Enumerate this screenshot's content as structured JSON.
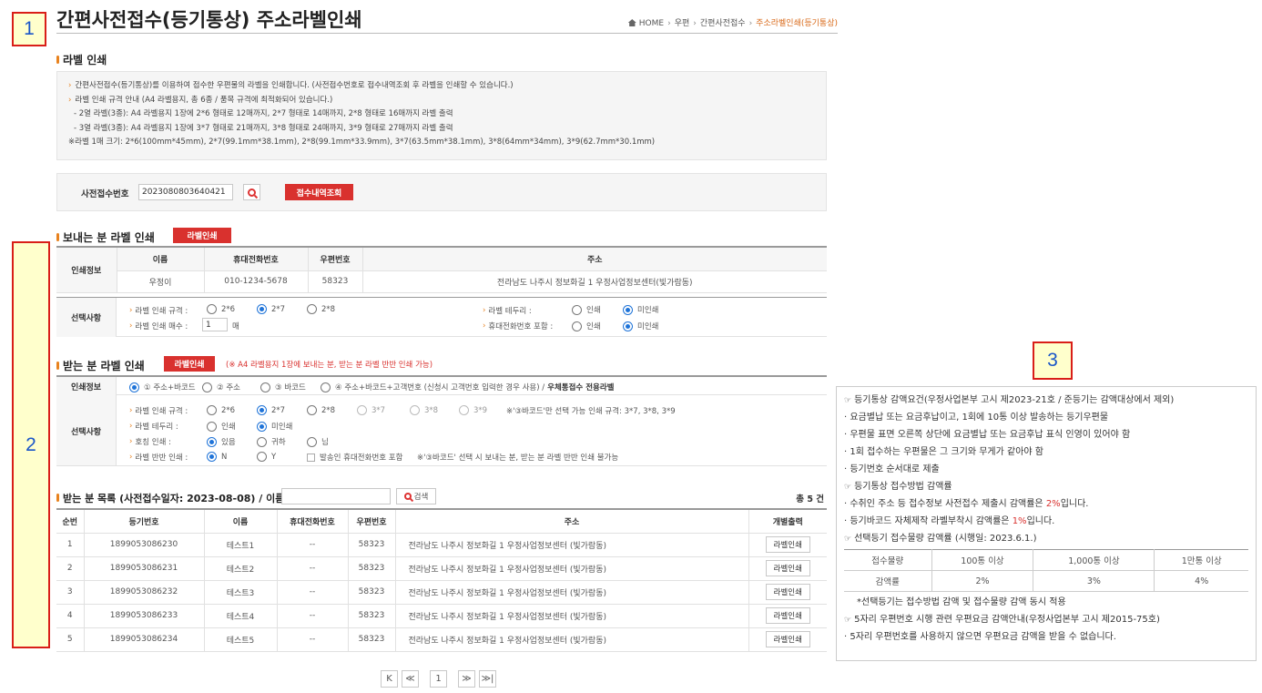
{
  "callouts": [
    "1",
    "2",
    "3"
  ],
  "page_title": "간편사전접수(등기통상) 주소라벨인쇄",
  "breadcrumb": {
    "home": "HOME",
    "items": [
      "우편",
      "간편사전접수",
      "주소라벨인쇄(등기통상)"
    ]
  },
  "label_print": {
    "heading": "라벨 인쇄",
    "info": [
      "간편사전접수(등기통상)를 이용하여 접수한 우편물의 라벨을 인쇄합니다. (사전접수번호로 접수내역조회 후 라벨을 인쇄할 수 있습니다.)",
      "라벨 인쇄 규격 안내 (A4 라벨용지, 총 6종 / 품목 규격에 최적화되어 있습니다.)",
      "- 2열 라벨(3종): A4 라벨용지 1장에 2*6 형태로 12매까지, 2*7 형태로 14매까지, 2*8 형태로 16매까지 라벨 출력",
      "- 3열 라벨(3종): A4 라벨용지 1장에 3*7 형태로 21매까지, 3*8 형태로 24매까지, 3*9 형태로 27매까지 라벨 출력",
      "※라벨 1매 크기: 2*6(100mm*45mm), 2*7(99.1mm*38.1mm), 2*8(99.1mm*33.9mm), 3*7(63.5mm*38.1mm), 3*8(64mm*34mm), 3*9(62.7mm*30.1mm)"
    ]
  },
  "search": {
    "label": "사전접수번호",
    "value": "2023080803640421",
    "button": "접수내역조회"
  },
  "sender": {
    "heading": "보내는 분 라벨 인쇄",
    "print_button": "라벨인쇄",
    "row_label": "인쇄정보",
    "columns": [
      "이름",
      "휴대전화번호",
      "우편번호",
      "주소"
    ],
    "values": [
      "우정이",
      "010-1234-5678",
      "58323",
      "전라남도 나주시 정보화길 1 우정사업정보센터(빛가람동)"
    ],
    "options_label": "선택사항",
    "size_label": "라벨 인쇄 규격 :",
    "sizes": [
      "2*6",
      "2*7",
      "2*8"
    ],
    "size_selected": "2*7",
    "count_label": "라벨 인쇄 매수 :",
    "count_value": "1",
    "count_unit": "매",
    "border_label": "라벨 테두리 :",
    "border_options": [
      "인쇄",
      "미인쇄"
    ],
    "border_selected": "미인쇄",
    "phone_label": "휴대전화번호 포함 :",
    "phone_options": [
      "인쇄",
      "미인쇄"
    ],
    "phone_selected": "미인쇄"
  },
  "receiver": {
    "heading": "받는 분 라벨 인쇄",
    "print_button": "라벨인쇄",
    "note": "(※ A4 라벨용지 1장에 보내는 분, 받는 분 라벨 반반 인쇄 가능)",
    "row_label": "인쇄정보",
    "types": [
      "① 주소+바코드",
      "② 주소",
      "③ 바코드",
      "④ 주소+바코드+고객번호 (신청시 고객번호 입력한 경우 사용) /"
    ],
    "type_bold": "우체통접수 전용라벨",
    "type_selected": "① 주소+바코드",
    "options_label": "선택사항",
    "size_label": "라벨 인쇄 규격 :",
    "sizes": [
      "2*6",
      "2*7",
      "2*8",
      "3*7",
      "3*8",
      "3*9"
    ],
    "size_selected": "2*7",
    "size_note": "※'③바코드'만 선택 가능 인쇄 규격: 3*7, 3*8, 3*9",
    "border_label": "라벨 테두리 :",
    "border_options": [
      "인쇄",
      "미인쇄"
    ],
    "border_selected": "미인쇄",
    "title_label": "호칭 인쇄 :",
    "title_options": [
      "있음",
      "귀하",
      "님"
    ],
    "title_selected": "있음",
    "half_label": "라벨 반반 인쇄 :",
    "half_options": [
      "N",
      "Y"
    ],
    "half_selected": "N",
    "sender_phone_checkbox": "발송인 휴대전화번호 포함",
    "half_note": "※'③바코드' 선택 시 보내는 분, 받는 분 라벨 반반 인쇄 불가능"
  },
  "list": {
    "heading": "받는 분 목록 (사전접수일자: 2023-08-08) / 이름",
    "search_placeholder": "",
    "search_button": "검색",
    "total": "총 5 건",
    "columns": [
      "순번",
      "등기번호",
      "이름",
      "휴대전화번호",
      "우편번호",
      "주소",
      "개별출력"
    ],
    "rows": [
      [
        "1",
        "1899053086230",
        "테스트1",
        "--",
        "58323",
        "전라남도 나주시 정보화길 1 우정사업정보센터 (빛가람동)",
        "라벨인쇄"
      ],
      [
        "2",
        "1899053086231",
        "테스트2",
        "--",
        "58323",
        "전라남도 나주시 정보화길 1 우정사업정보센터 (빛가람동)",
        "라벨인쇄"
      ],
      [
        "3",
        "1899053086232",
        "테스트3",
        "--",
        "58323",
        "전라남도 나주시 정보화길 1 우정사업정보센터 (빛가람동)",
        "라벨인쇄"
      ],
      [
        "4",
        "1899053086233",
        "테스트4",
        "--",
        "58323",
        "전라남도 나주시 정보화길 1 우정사업정보센터 (빛가람동)",
        "라벨인쇄"
      ],
      [
        "5",
        "1899053086234",
        "테스트5",
        "--",
        "58323",
        "전라남도 나주시 정보화길 1 우정사업정보센터 (빛가람동)",
        "라벨인쇄"
      ]
    ]
  },
  "pagination": {
    "first": "K",
    "prev": "≪",
    "current": "1",
    "next": "≫",
    "last": "≫|"
  },
  "right_panel": {
    "line1": "등기통상 감액요건(우정사업본부 고시 제2023-21호 / 준등기는 감액대상에서 제외)",
    "bullets1": [
      "· 요금별납 또는 요금후납이고, 1회에 10통 이상 발송하는 등기우편물",
      "· 우편물 표면 오른쪽 상단에 요금별납 또는 요금후납 표식 인영이 있어야 함",
      "· 1회 접수하는 우편물은 그 크기와 무게가 같아야 함",
      "· 등기번호 순서대로 제출"
    ],
    "line2": "등기통상 접수방법 감액률",
    "b2a_pre": "· 수취인 주소 등 접수정보 사전접수 제출시 감액률은 ",
    "b2a_red": "2%",
    "b2a_post": "입니다.",
    "b2b_pre": "· 등기바코드 자체제작 라벨부착시 감액률은 ",
    "b2b_red": "1%",
    "b2b_post": "입니다.",
    "line3": "선택등기 접수물량 감액률 (시행일: 2023.6.1.)",
    "table": [
      [
        "접수물량",
        "100통 이상",
        "1,000통 이상",
        "1만통 이상"
      ],
      [
        "감액률",
        "2%",
        "3%",
        "4%"
      ]
    ],
    "note": "*선택등기는 접수방법 감액 및 접수물량 감액 동시 적용",
    "line4": "5자리 우편번호 시행 관련 우편요금 감액안내(우정사업본부 고시 제2015-75호)",
    "bullet4": "· 5자리 우편번호를 사용하지 않으면 우편요금 감액을 받을 수 없습니다.",
    "hand": "☞"
  }
}
